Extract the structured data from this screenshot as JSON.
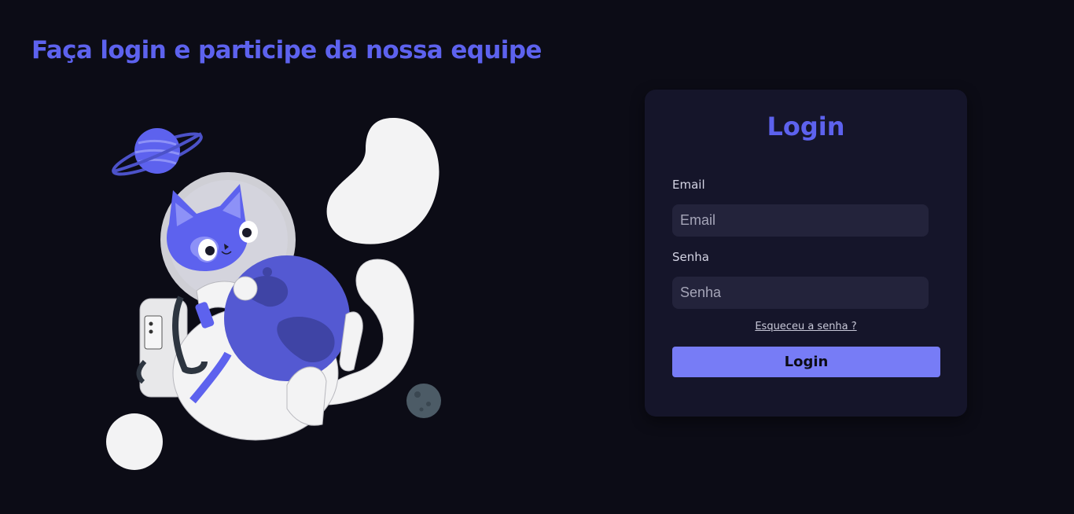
{
  "header": {
    "title": "Faça login e participe da nossa equipe"
  },
  "illustration": {
    "name": "astronaut-cat-illustration"
  },
  "login": {
    "title": "Login",
    "email_label": "Email",
    "email_placeholder": "Email",
    "password_label": "Senha",
    "password_placeholder": "Senha",
    "forgot_label": "Esqueceu a senha ?",
    "submit_label": "Login"
  },
  "colors": {
    "background": "#0c0c16",
    "card": "#15152a",
    "accent": "#5d62ee",
    "button": "#777cf6",
    "input": "#23233b"
  }
}
